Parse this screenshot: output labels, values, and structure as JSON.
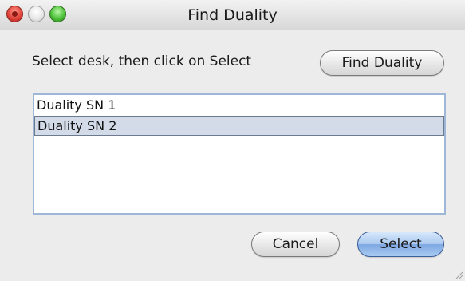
{
  "window": {
    "title": "Find Duality"
  },
  "dialog": {
    "prompt": "Select desk, then click on Select",
    "find_button_label": "Find Duality",
    "list": {
      "items": [
        {
          "label": "Duality SN 1",
          "selected": false
        },
        {
          "label": "Duality SN 2",
          "selected": true
        }
      ]
    },
    "cancel_button_label": "Cancel",
    "select_button_label": "Select"
  },
  "colors": {
    "selection_background": "#d4dbe8",
    "default_button": "#7ea7e2",
    "window_background": "#ececec"
  }
}
